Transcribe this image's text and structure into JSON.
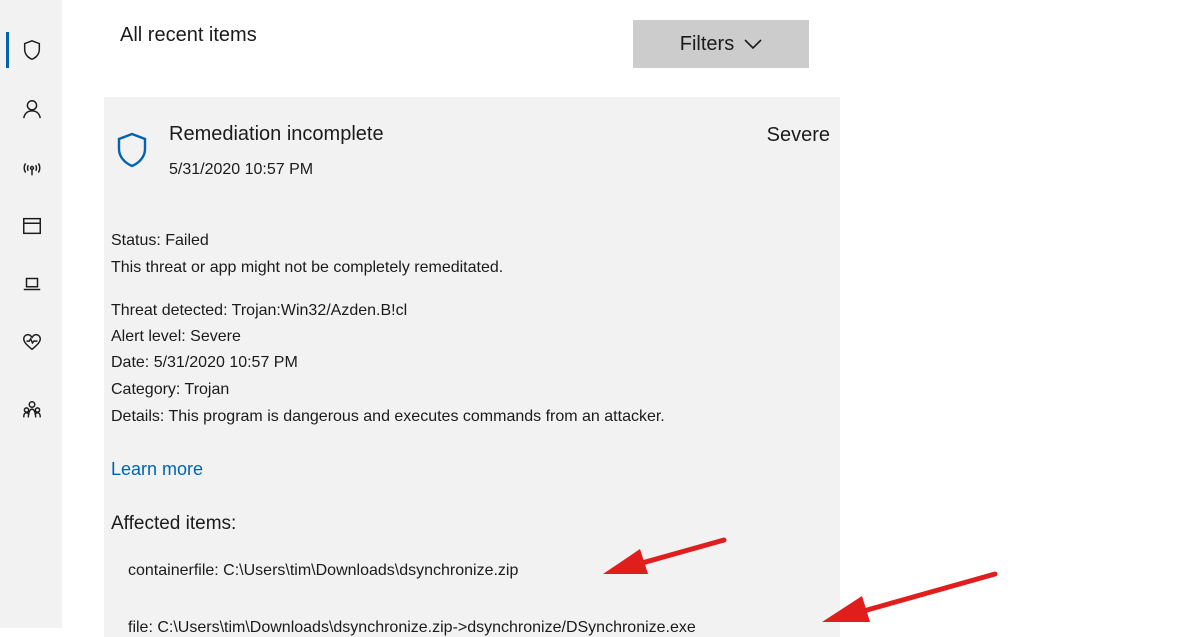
{
  "nav": {
    "items": [
      {
        "icon": "shield-icon"
      },
      {
        "icon": "person-icon"
      },
      {
        "icon": "wireless-icon"
      },
      {
        "icon": "window-icon"
      },
      {
        "icon": "laptop-icon"
      },
      {
        "icon": "heart-icon"
      },
      {
        "icon": "family-icon"
      }
    ]
  },
  "header": {
    "title": "All recent items",
    "filters_label": "Filters"
  },
  "card": {
    "title": "Remediation incomplete",
    "date": "5/31/2020 10:57 PM",
    "severity": "Severe",
    "status": "Status: Failed",
    "status_detail": "This threat or app might not be completely remeditated.",
    "threat": "Threat detected:  Trojan:Win32/Azden.B!cl",
    "alert_level": "Alert level:  Severe",
    "date_line": "Date:  5/31/2020 10:57 PM",
    "category": "Category:  Trojan",
    "details": "Details:  This program is dangerous and executes commands from an attacker.",
    "learn_more": "Learn more",
    "affected_heading": "Affected items:",
    "affected_items": [
      "containerfile:  C:\\Users\\tim\\Downloads\\dsynchronize.zip",
      "file:  C:\\Users\\tim\\Downloads\\dsynchronize.zip->dsynchronize/DSynchronize.exe"
    ]
  },
  "colors": {
    "accent": "#0063b1",
    "annotation_arrow": "#e01e1e",
    "card_bg": "#f2f2f2",
    "button_bg": "#cccccc"
  }
}
